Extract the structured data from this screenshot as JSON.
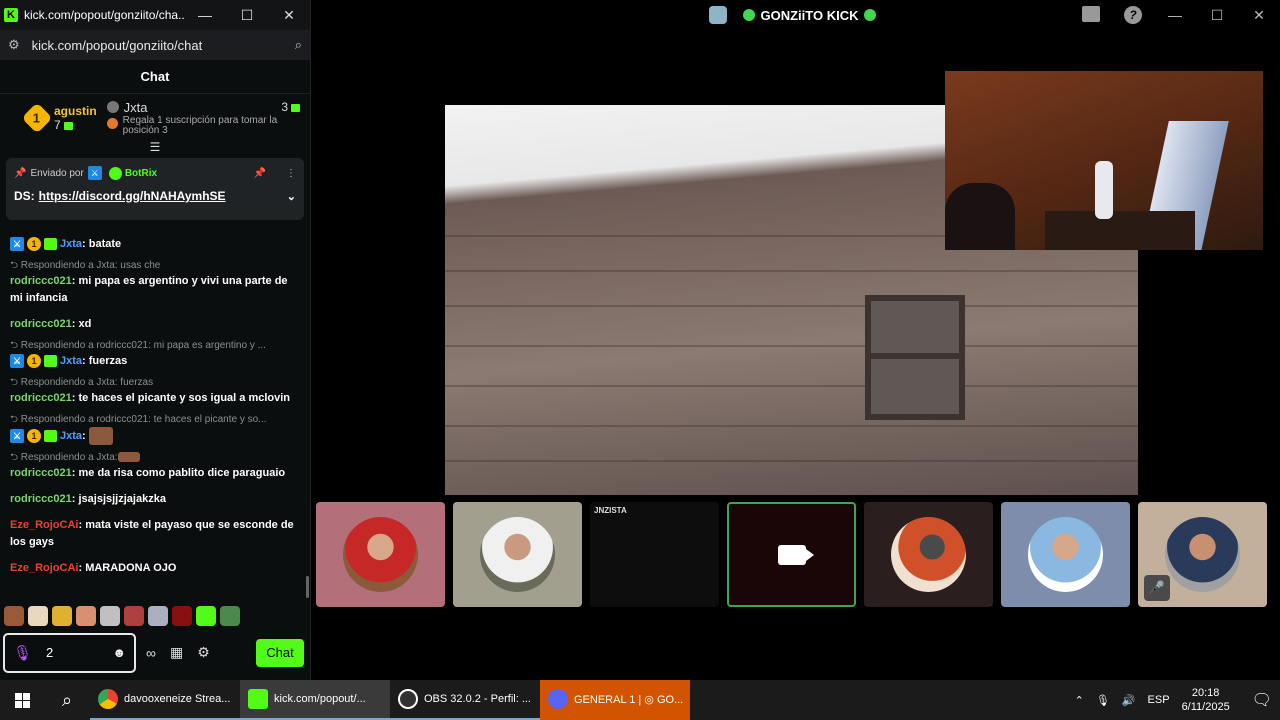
{
  "chat_window": {
    "title": "kick.com/popout/gonziito/cha...",
    "url": "kick.com/popout/gonziito/chat",
    "header": "Chat",
    "leaderboard": {
      "first": {
        "name": "agustin",
        "rank": "1",
        "count": "7"
      },
      "second": {
        "name": "Jxta",
        "count": "3",
        "hint": "Regala 1 suscripción para tomar la posición 3"
      }
    },
    "pinned": {
      "sent_by_label": "Enviado por",
      "sender": "BotRix",
      "text_prefix": "DS:",
      "link": "https://discord.gg/hNAHAymhSE"
    },
    "messages": [
      {
        "type": "msg",
        "user": "Jxta",
        "color": "blue",
        "badges": true,
        "text": ": batate"
      },
      {
        "type": "reply",
        "text": "Respondiendo a Jxta: usas che"
      },
      {
        "type": "msg",
        "user": "rodriccc021",
        "color": "green",
        "text": ": mi papa es argentino y vivi una parte de mi infancia"
      },
      {
        "type": "msg",
        "user": "rodriccc021",
        "color": "green",
        "text": ": xd"
      },
      {
        "type": "reply",
        "text": "Respondiendo a rodriccc021: mi papa es argentino y ..."
      },
      {
        "type": "msg",
        "user": "Jxta",
        "color": "blue",
        "badges": true,
        "text": ": fuerzas"
      },
      {
        "type": "reply",
        "text": "Respondiendo a Jxta: fuerzas"
      },
      {
        "type": "msg",
        "user": "rodriccc021",
        "color": "green",
        "text": ": te haces el picante y sos igual a mclovin"
      },
      {
        "type": "reply",
        "text": "Respondiendo a rodriccc021: te haces el picante y so..."
      },
      {
        "type": "msg",
        "user": "Jxta",
        "color": "blue",
        "badges": true,
        "text": ":",
        "emote": true
      },
      {
        "type": "reply",
        "text": "Respondiendo a Jxta:",
        "emote": true
      },
      {
        "type": "msg",
        "user": "rodriccc021",
        "color": "green",
        "text": ": me da risa como pablito dice paraguaio"
      },
      {
        "type": "msg",
        "user": "rodriccc021",
        "color": "green",
        "text": ": jsajsjsjjzjajakzka"
      },
      {
        "type": "msg",
        "user": "Eze_RojoCAi",
        "color": "red",
        "text": ": mata viste el payaso que se esconde de los gays"
      },
      {
        "type": "msg",
        "user": "Eze_RojoCAi",
        "color": "red",
        "text": ": MARADONA OJO"
      }
    ],
    "input_value": "2",
    "chat_button": "Chat"
  },
  "discord": {
    "title": "GONZiiTO KICK",
    "tile_label": "JNZISTA"
  },
  "taskbar": {
    "apps": [
      {
        "label": "davooxeneize Strea...",
        "icon_color": "#4285f4"
      },
      {
        "label": "kick.com/popout/...",
        "icon_color": "#53fc18"
      },
      {
        "label": "OBS 32.0.2 - Perfil: ...",
        "icon_color": "#333333"
      },
      {
        "label": "GENERAL 1 | ◎ GO...",
        "icon_color": "#5865f2"
      }
    ],
    "lang": "ESP",
    "time": "20:18",
    "date": "6/11/2025"
  }
}
